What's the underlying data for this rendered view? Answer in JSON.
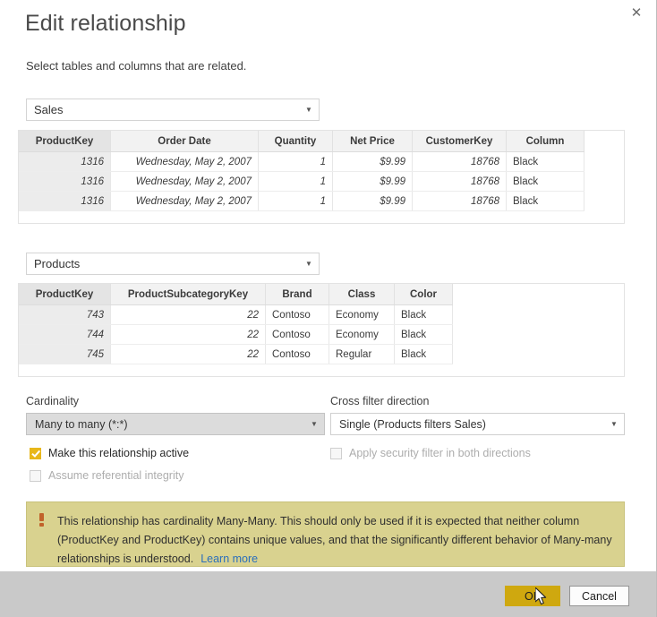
{
  "dialog": {
    "title": "Edit relationship",
    "subtitle": "Select tables and columns that are related.",
    "close_icon": "close-icon"
  },
  "from_table": {
    "label": "from-table-select",
    "value": "Sales",
    "caret_icon": "chevron-down-icon",
    "columns": [
      "ProductKey",
      "Order Date",
      "Quantity",
      "Net Price",
      "CustomerKey",
      "Column"
    ],
    "selected_column": "ProductKey",
    "rows": [
      [
        "1316",
        "Wednesday, May 2, 2007",
        "1",
        "$9.99",
        "18768",
        "Black"
      ],
      [
        "1316",
        "Wednesday, May 2, 2007",
        "1",
        "$9.99",
        "18768",
        "Black"
      ],
      [
        "1316",
        "Wednesday, May 2, 2007",
        "1",
        "$9.99",
        "18768",
        "Black"
      ]
    ]
  },
  "to_table": {
    "label": "to-table-select",
    "value": "Products",
    "caret_icon": "chevron-down-icon",
    "columns": [
      "ProductKey",
      "ProductSubcategoryKey",
      "Brand",
      "Class",
      "Color"
    ],
    "selected_column": "ProductKey",
    "rows": [
      [
        "743",
        "22",
        "Contoso",
        "Economy",
        "Black"
      ],
      [
        "744",
        "22",
        "Contoso",
        "Economy",
        "Black"
      ],
      [
        "745",
        "22",
        "Contoso",
        "Regular",
        "Black"
      ]
    ]
  },
  "cardinality": {
    "label": "Cardinality",
    "value": "Many to many (*:*)",
    "caret_icon": "chevron-down-icon"
  },
  "cross_filter": {
    "label": "Cross filter direction",
    "value": "Single (Products filters Sales)",
    "caret_icon": "chevron-down-icon"
  },
  "checkboxes": {
    "make_active": {
      "label": "Make this relationship active",
      "checked": true,
      "disabled": false
    },
    "apply_security": {
      "label": "Apply security filter in both directions",
      "checked": false,
      "disabled": true
    },
    "assume_referential": {
      "label": "Assume referential integrity",
      "checked": false,
      "disabled": true
    }
  },
  "warning": {
    "icon": "warning-icon",
    "text": "This relationship has cardinality Many-Many. This should only be used if it is expected that neither column (ProductKey and ProductKey) contains unique values, and that the significantly different behavior of Many-many relationships is understood.",
    "link": "Learn more"
  },
  "footer": {
    "ok_label": "OK",
    "cancel_label": "Cancel"
  },
  "colors": {
    "accent_yellow": "#e8b71a",
    "ok_button": "#cfa80f",
    "warning_bg": "#d9d28f",
    "link_blue": "#2b6fbb",
    "footer_bg": "#c9c9c9"
  }
}
